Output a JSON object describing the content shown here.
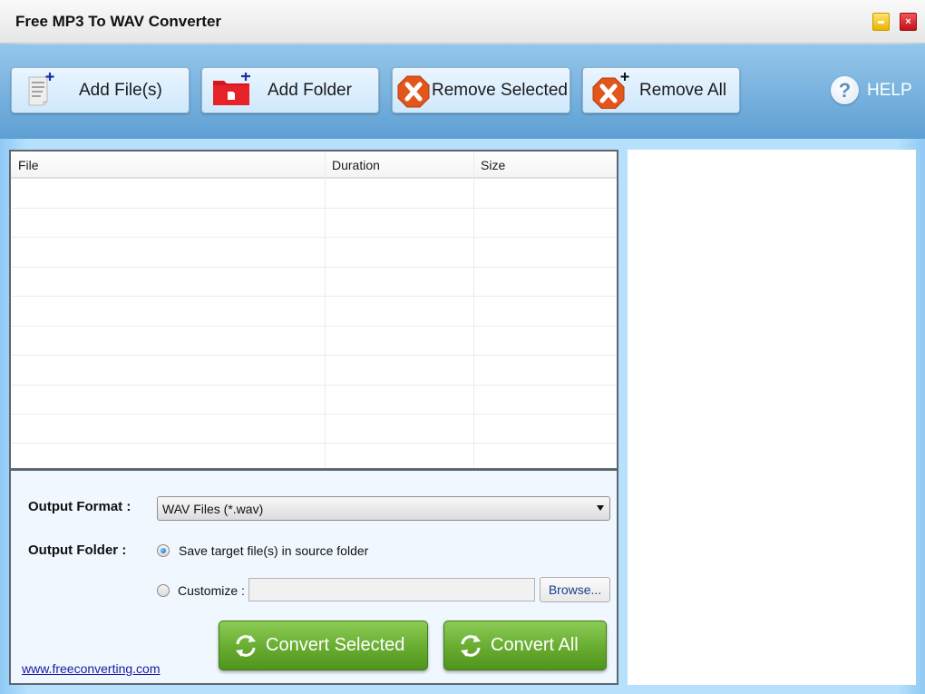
{
  "window": {
    "title": "Free MP3 To WAV Converter",
    "controls": {
      "minimize": "minimize",
      "close": "×"
    }
  },
  "toolbar": {
    "add_files": {
      "label": "Add File(s)",
      "icon": "file-add-icon"
    },
    "add_folder": {
      "label": "Add Folder",
      "icon": "folder-add-icon"
    },
    "remove_selected": {
      "label": "Remove Selected",
      "icon": "remove-icon"
    },
    "remove_all": {
      "label": "Remove All",
      "icon": "remove-all-icon"
    },
    "help": {
      "label": "HELP",
      "glyph": "?"
    }
  },
  "file_table": {
    "columns": [
      "File",
      "Duration",
      "Size"
    ],
    "rows": []
  },
  "settings": {
    "output_format_label": "Output Format :",
    "output_format_value": "WAV Files (*.wav)",
    "output_folder_label": "Output Folder :",
    "option_source": {
      "label": "Save target file(s) in source folder",
      "selected": true
    },
    "option_customize": {
      "label": "Customize :",
      "selected": false
    },
    "custom_path_value": "",
    "browse_label": "Browse..."
  },
  "actions": {
    "convert_selected": "Convert Selected",
    "convert_all": "Convert All"
  },
  "footer": {
    "website_link": "www.freeconverting.com"
  },
  "colors": {
    "toolbar_blue": "#7ab3df",
    "convert_green": "#6aaf33",
    "remove_orange": "#e2561b",
    "folder_red": "#d8151c",
    "link_blue": "#1a1aa0"
  }
}
